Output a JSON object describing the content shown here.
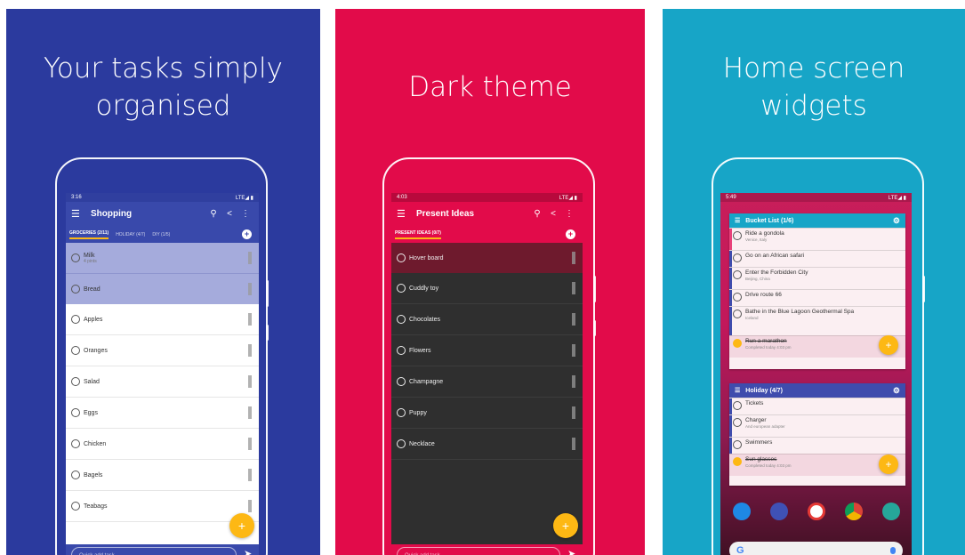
{
  "panels": [
    {
      "title_line1": "Your tasks simply",
      "title_line2": "organised",
      "bg": "#2b3a9e"
    },
    {
      "title_line1": "Dark theme",
      "title_line2": "",
      "bg": "#e20b4a"
    },
    {
      "title_line1": "Home screen",
      "title_line2": "widgets",
      "bg": "#17a5c7"
    }
  ],
  "phone1": {
    "time": "3:16",
    "status_right": "LTE◢ ▮",
    "title": "Shopping",
    "tabs": [
      "GROCERIES (2/11)",
      "HOLIDAY (4/7)",
      "DIY (1/5)"
    ],
    "items": [
      {
        "label": "Milk",
        "sub": "4 pints"
      },
      {
        "label": "Bread",
        "sub": ""
      },
      {
        "label": "Apples",
        "sub": ""
      },
      {
        "label": "Oranges",
        "sub": ""
      },
      {
        "label": "Salad",
        "sub": ""
      },
      {
        "label": "Eggs",
        "sub": ""
      },
      {
        "label": "Chicken",
        "sub": ""
      },
      {
        "label": "Bagels",
        "sub": ""
      },
      {
        "label": "Teabags",
        "sub": ""
      }
    ],
    "quick_add": "Quick add task..."
  },
  "phone2": {
    "time": "4:03",
    "status_right": "LTE◢ ▮",
    "title": "Present Ideas",
    "tab": "PRESENT IDEAS (0/7)",
    "items": [
      "Hover board",
      "Cuddly toy",
      "Chocolates",
      "Flowers",
      "Champagne",
      "Puppy",
      "Necklace"
    ],
    "quick_add": "Quick add task..."
  },
  "phone3": {
    "time": "5:49",
    "status_right": "LTE◢ ▮",
    "widget1": {
      "title": "Bucket List (1/6)",
      "items": [
        {
          "label": "Ride a gondola",
          "sub": "Venice, Italy",
          "done": false
        },
        {
          "label": "Go on an African safari",
          "sub": "",
          "done": false
        },
        {
          "label": "Enter the Forbidden City",
          "sub": "Beijing, China",
          "done": false
        },
        {
          "label": "Drive route 66",
          "sub": "",
          "done": false
        },
        {
          "label": "Bathe in the Blue Lagoon Geothermal Spa",
          "sub": "Iceland",
          "done": false
        },
        {
          "label": "Run a marathon",
          "sub": "Completed today 4:03 pm",
          "done": true
        }
      ]
    },
    "widget2": {
      "title": "Holiday (4/7)",
      "items": [
        {
          "label": "Tickets",
          "sub": "",
          "done": false
        },
        {
          "label": "Charger",
          "sub": "And european adapter",
          "done": false
        },
        {
          "label": "Swimmers",
          "sub": "",
          "done": false
        },
        {
          "label": "Sun glasses",
          "sub": "Completed today 4:03 pm",
          "done": true
        }
      ]
    },
    "search_logo": "G"
  },
  "icons": {
    "menu": "☰",
    "search": "⚲",
    "share": "<",
    "more": "⋮",
    "add": "+",
    "send": "➤",
    "gear": "⚙"
  },
  "colors": {
    "indigo": "#3949ab",
    "pink_red": "#e20b4a",
    "teal": "#17a5c7",
    "accent_yellow": "#fdb814",
    "dark_bg": "#2f2f2f",
    "selected_row": "#a5abdc",
    "widget_pink": "#e8417a",
    "widget_indigo": "#3f4cad"
  }
}
